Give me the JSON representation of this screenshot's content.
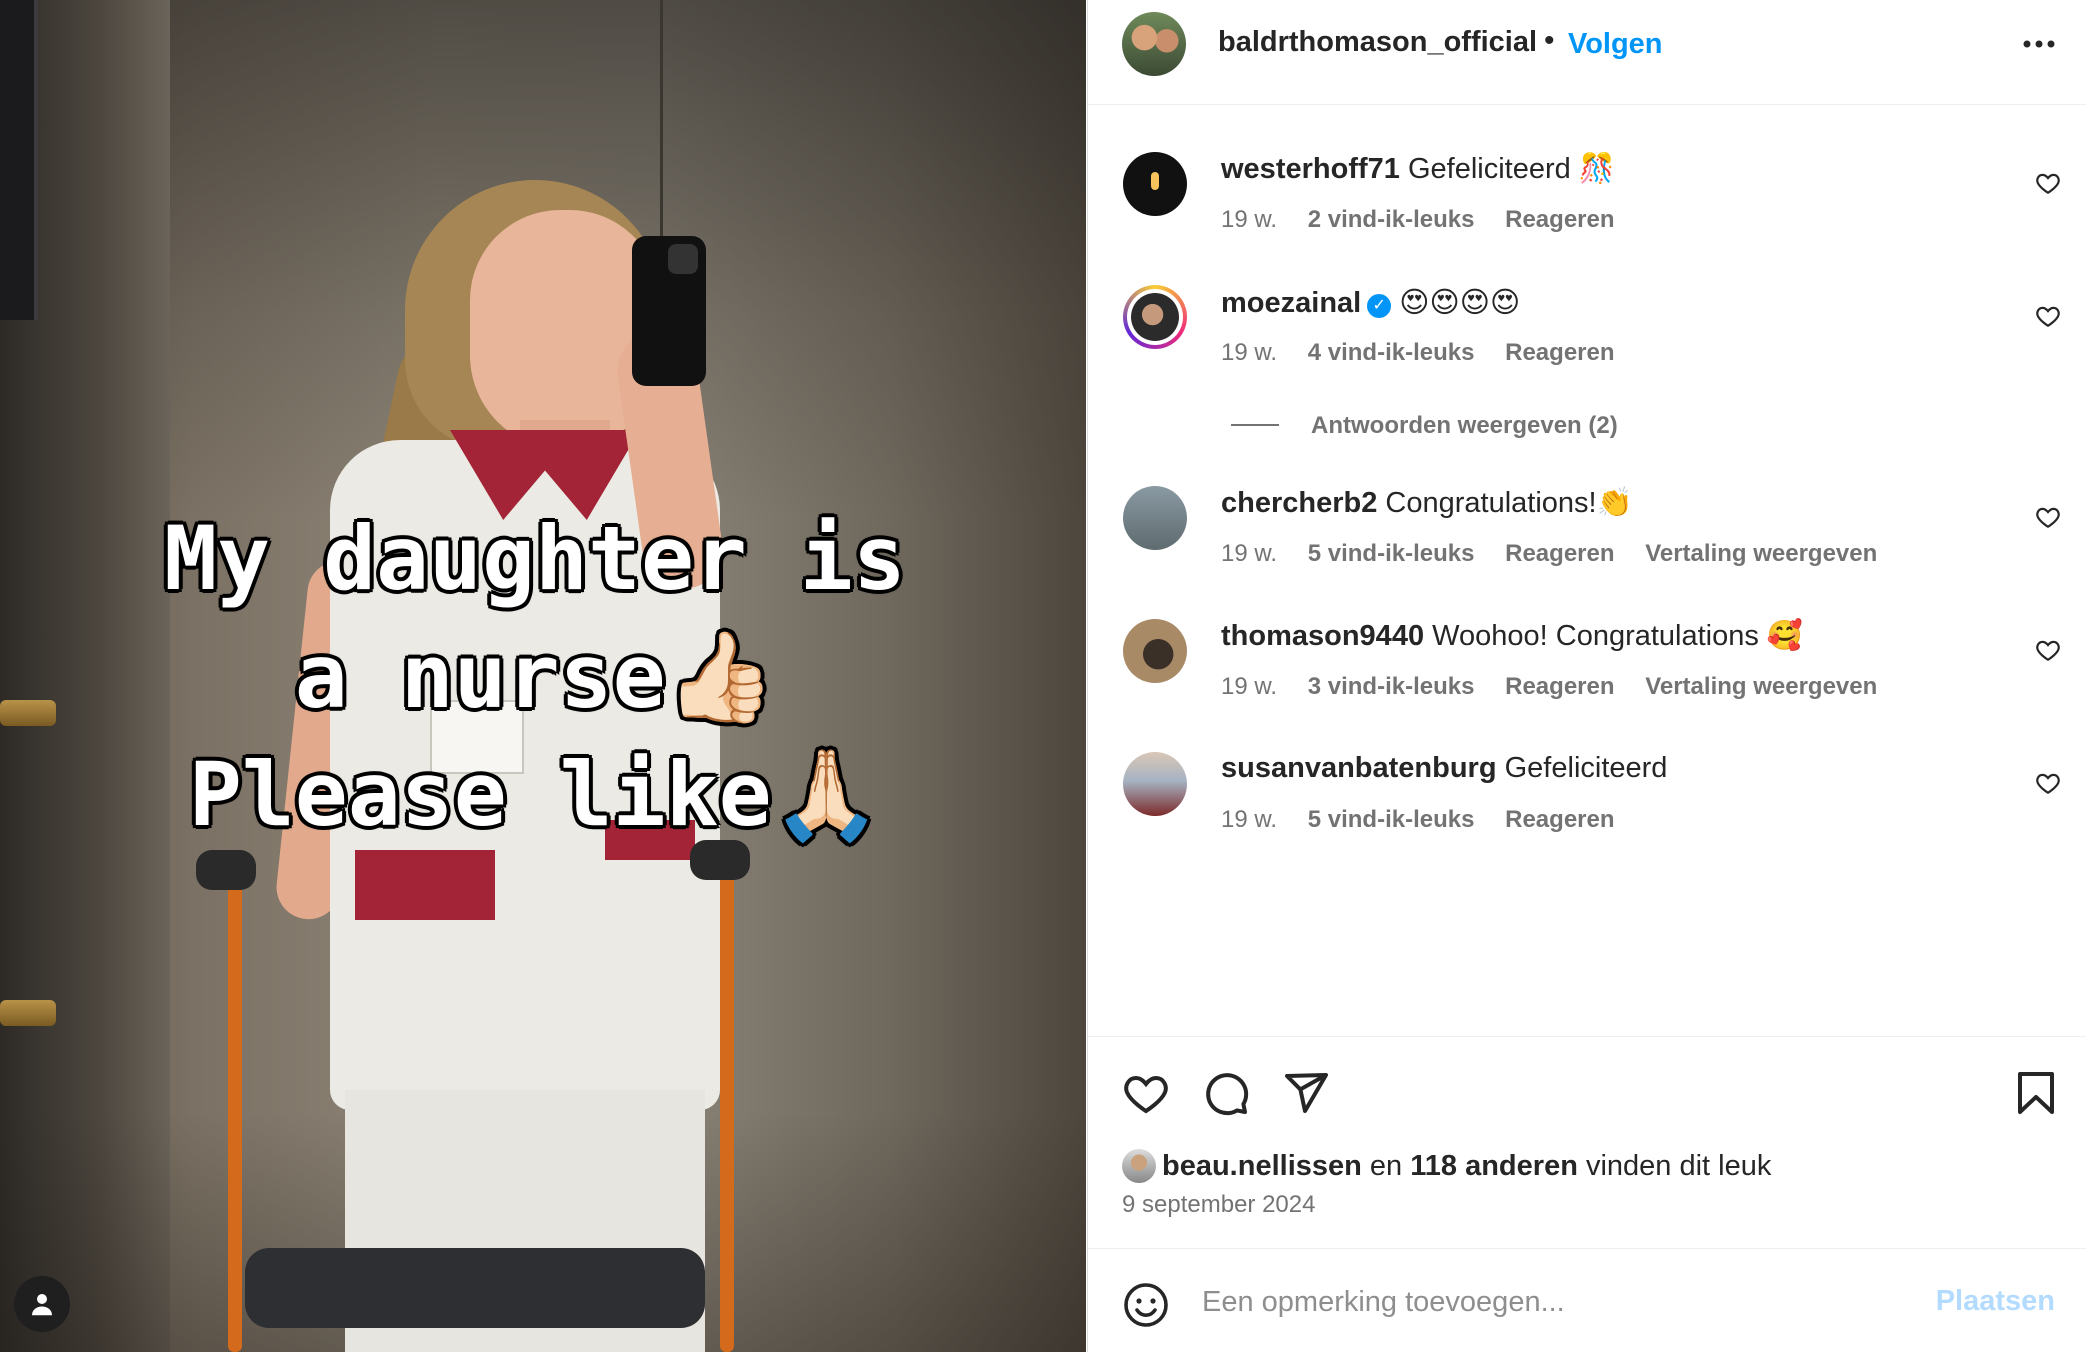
{
  "post": {
    "overlay_text": "My daughter is\na nurse👍🏻\nPlease like🙏🏻"
  },
  "header": {
    "username": "baldrthomason_official",
    "separator": "•",
    "follow_label": "Volgen",
    "more_icon": "more-horizontal-icon"
  },
  "comments": [
    {
      "username": "westerhoff71",
      "text": "Gefeliciteerd 🎊",
      "time": "19 w.",
      "likes": "2 vind-ik-leuks",
      "reply": "Reageren",
      "translate": ""
    },
    {
      "username": "moezainal",
      "verified": true,
      "text": "😍😍😍😍",
      "time": "19 w.",
      "likes": "4 vind-ik-leuks",
      "reply": "Reageren",
      "translate": "",
      "view_replies": "Antwoorden weergeven (2)"
    },
    {
      "username": "chercherb2",
      "text": "Congratulations!👏",
      "time": "19 w.",
      "likes": "5 vind-ik-leuks",
      "reply": "Reageren",
      "translate": "Vertaling weergeven"
    },
    {
      "username": "thomason9440",
      "text": "Woohoo! Congratulations 🥰",
      "time": "19 w.",
      "likes": "3 vind-ik-leuks",
      "reply": "Reageren",
      "translate": "Vertaling weergeven"
    },
    {
      "username": "susanvanbatenburg",
      "text": "Gefeliciteerd",
      "time": "19 w.",
      "likes": "5 vind-ik-leuks",
      "reply": "Reageren",
      "translate": ""
    }
  ],
  "actions": {
    "like_icon": "heart-icon",
    "comment_icon": "comment-icon",
    "share_icon": "send-icon",
    "save_icon": "bookmark-icon"
  },
  "likes": {
    "first_user": "beau.nellissen",
    "connector": "en",
    "others": "118 anderen",
    "suffix": "vinden dit leuk"
  },
  "date": "9 september 2024",
  "composer": {
    "placeholder": "Een opmerking toevoegen...",
    "post_label": "Plaatsen"
  },
  "colors": {
    "accent": "#0095f6",
    "post_disabled": "#b3dbff",
    "secondary_text": "#737373"
  }
}
